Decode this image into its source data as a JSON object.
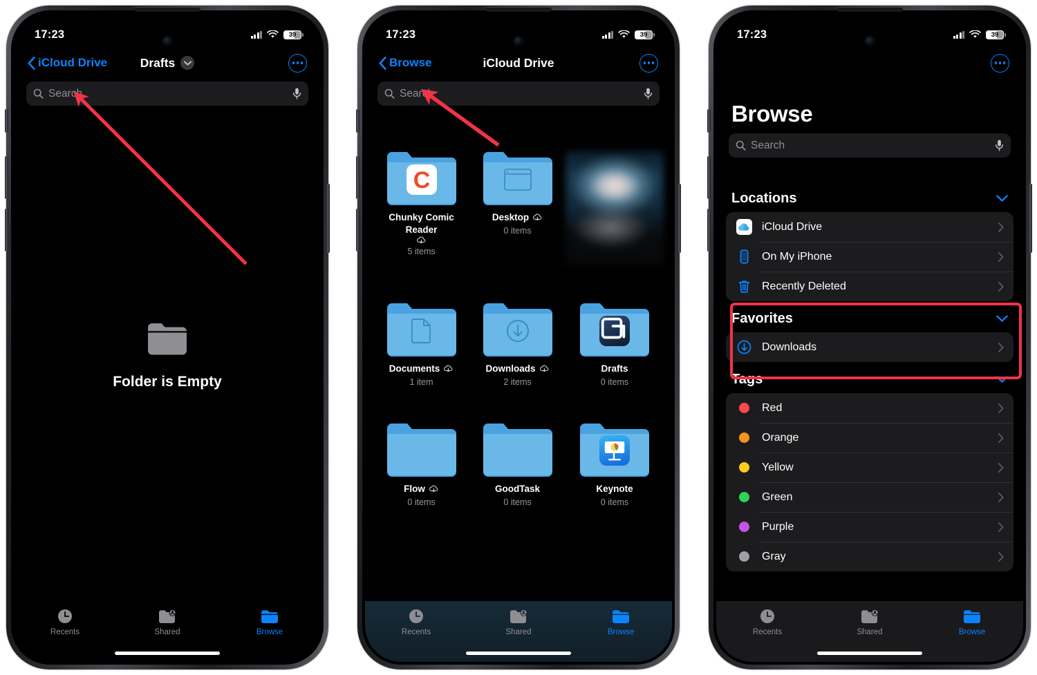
{
  "accent": "#0a84ff",
  "annotation_color": "#f23347",
  "status_bar": {
    "time": "17:23",
    "battery": "39",
    "signal_icon": "cellular-bars-icon",
    "wifi_icon": "wifi-icon",
    "battery_icon": "battery-icon"
  },
  "search": {
    "placeholder": "Search",
    "search_icon": "search-icon",
    "mic_icon": "microphone-icon"
  },
  "tabbar": {
    "items": [
      {
        "label": "Recents",
        "icon": "clock-icon",
        "active": false
      },
      {
        "label": "Shared",
        "icon": "shared-folder-person-icon",
        "active": false
      },
      {
        "label": "Browse",
        "icon": "folder-icon",
        "active": true
      }
    ]
  },
  "phone1": {
    "nav": {
      "back_label": "iCloud Drive",
      "title": "Drafts",
      "caret_icon": "chevron-down-icon",
      "more_icon": "ellipsis-circle-icon",
      "back_icon": "chevron-left-icon"
    },
    "empty_state": {
      "label": "Folder is Empty",
      "icon": "folder-icon"
    }
  },
  "phone2": {
    "nav": {
      "back_label": "Browse",
      "title": "iCloud Drive",
      "more_icon": "ellipsis-circle-icon",
      "back_icon": "chevron-left-icon"
    },
    "items": [
      {
        "name": "Chunky Comic Reader",
        "count": "5 items",
        "cloud": true,
        "badge": "chunky-comic-reader-app-icon"
      },
      {
        "name": "Desktop",
        "count": "0 items",
        "cloud": true,
        "badge": "desktop-window-icon"
      },
      {
        "name": "",
        "count": "",
        "cloud": false,
        "badge": "blurred-photo-thumbnail"
      },
      {
        "name": "Documents",
        "count": "1 item",
        "cloud": true,
        "badge": "document-page-icon"
      },
      {
        "name": "Downloads",
        "count": "2 items",
        "cloud": true,
        "badge": "download-arrow-icon"
      },
      {
        "name": "Drafts",
        "count": "0 items",
        "cloud": false,
        "badge": "drafts-app-icon"
      },
      {
        "name": "Flow",
        "count": "0 items",
        "cloud": true,
        "badge": ""
      },
      {
        "name": "GoodTask",
        "count": "0 items",
        "cloud": false,
        "badge": ""
      },
      {
        "name": "Keynote",
        "count": "0 items",
        "cloud": false,
        "badge": "keynote-app-icon"
      }
    ]
  },
  "phone3": {
    "title": "Browse",
    "more_icon": "ellipsis-circle-icon",
    "sections": [
      {
        "title": "Locations",
        "collapse_icon": "chevron-down-icon",
        "highlighted": false,
        "rows": [
          {
            "label": "iCloud Drive",
            "icon": "icloud-icon",
            "color": ""
          },
          {
            "label": "On My iPhone",
            "icon": "iphone-icon",
            "color": ""
          },
          {
            "label": "Recently Deleted",
            "icon": "trash-icon",
            "color": ""
          }
        ]
      },
      {
        "title": "Favorites",
        "collapse_icon": "chevron-down-icon",
        "highlighted": true,
        "rows": [
          {
            "label": "Downloads",
            "icon": "download-circle-icon",
            "color": ""
          }
        ]
      },
      {
        "title": "Tags",
        "collapse_icon": "chevron-down-icon",
        "highlighted": false,
        "rows": [
          {
            "label": "Red",
            "icon": "tag-dot-icon",
            "color": "#f8484a"
          },
          {
            "label": "Orange",
            "icon": "tag-dot-icon",
            "color": "#f79319"
          },
          {
            "label": "Yellow",
            "icon": "tag-dot-icon",
            "color": "#fecc19"
          },
          {
            "label": "Green",
            "icon": "tag-dot-icon",
            "color": "#2fd15a"
          },
          {
            "label": "Purple",
            "icon": "tag-dot-icon",
            "color": "#c554e8"
          },
          {
            "label": "Gray",
            "icon": "tag-dot-icon",
            "color": "#a0a0a5"
          }
        ]
      }
    ]
  }
}
